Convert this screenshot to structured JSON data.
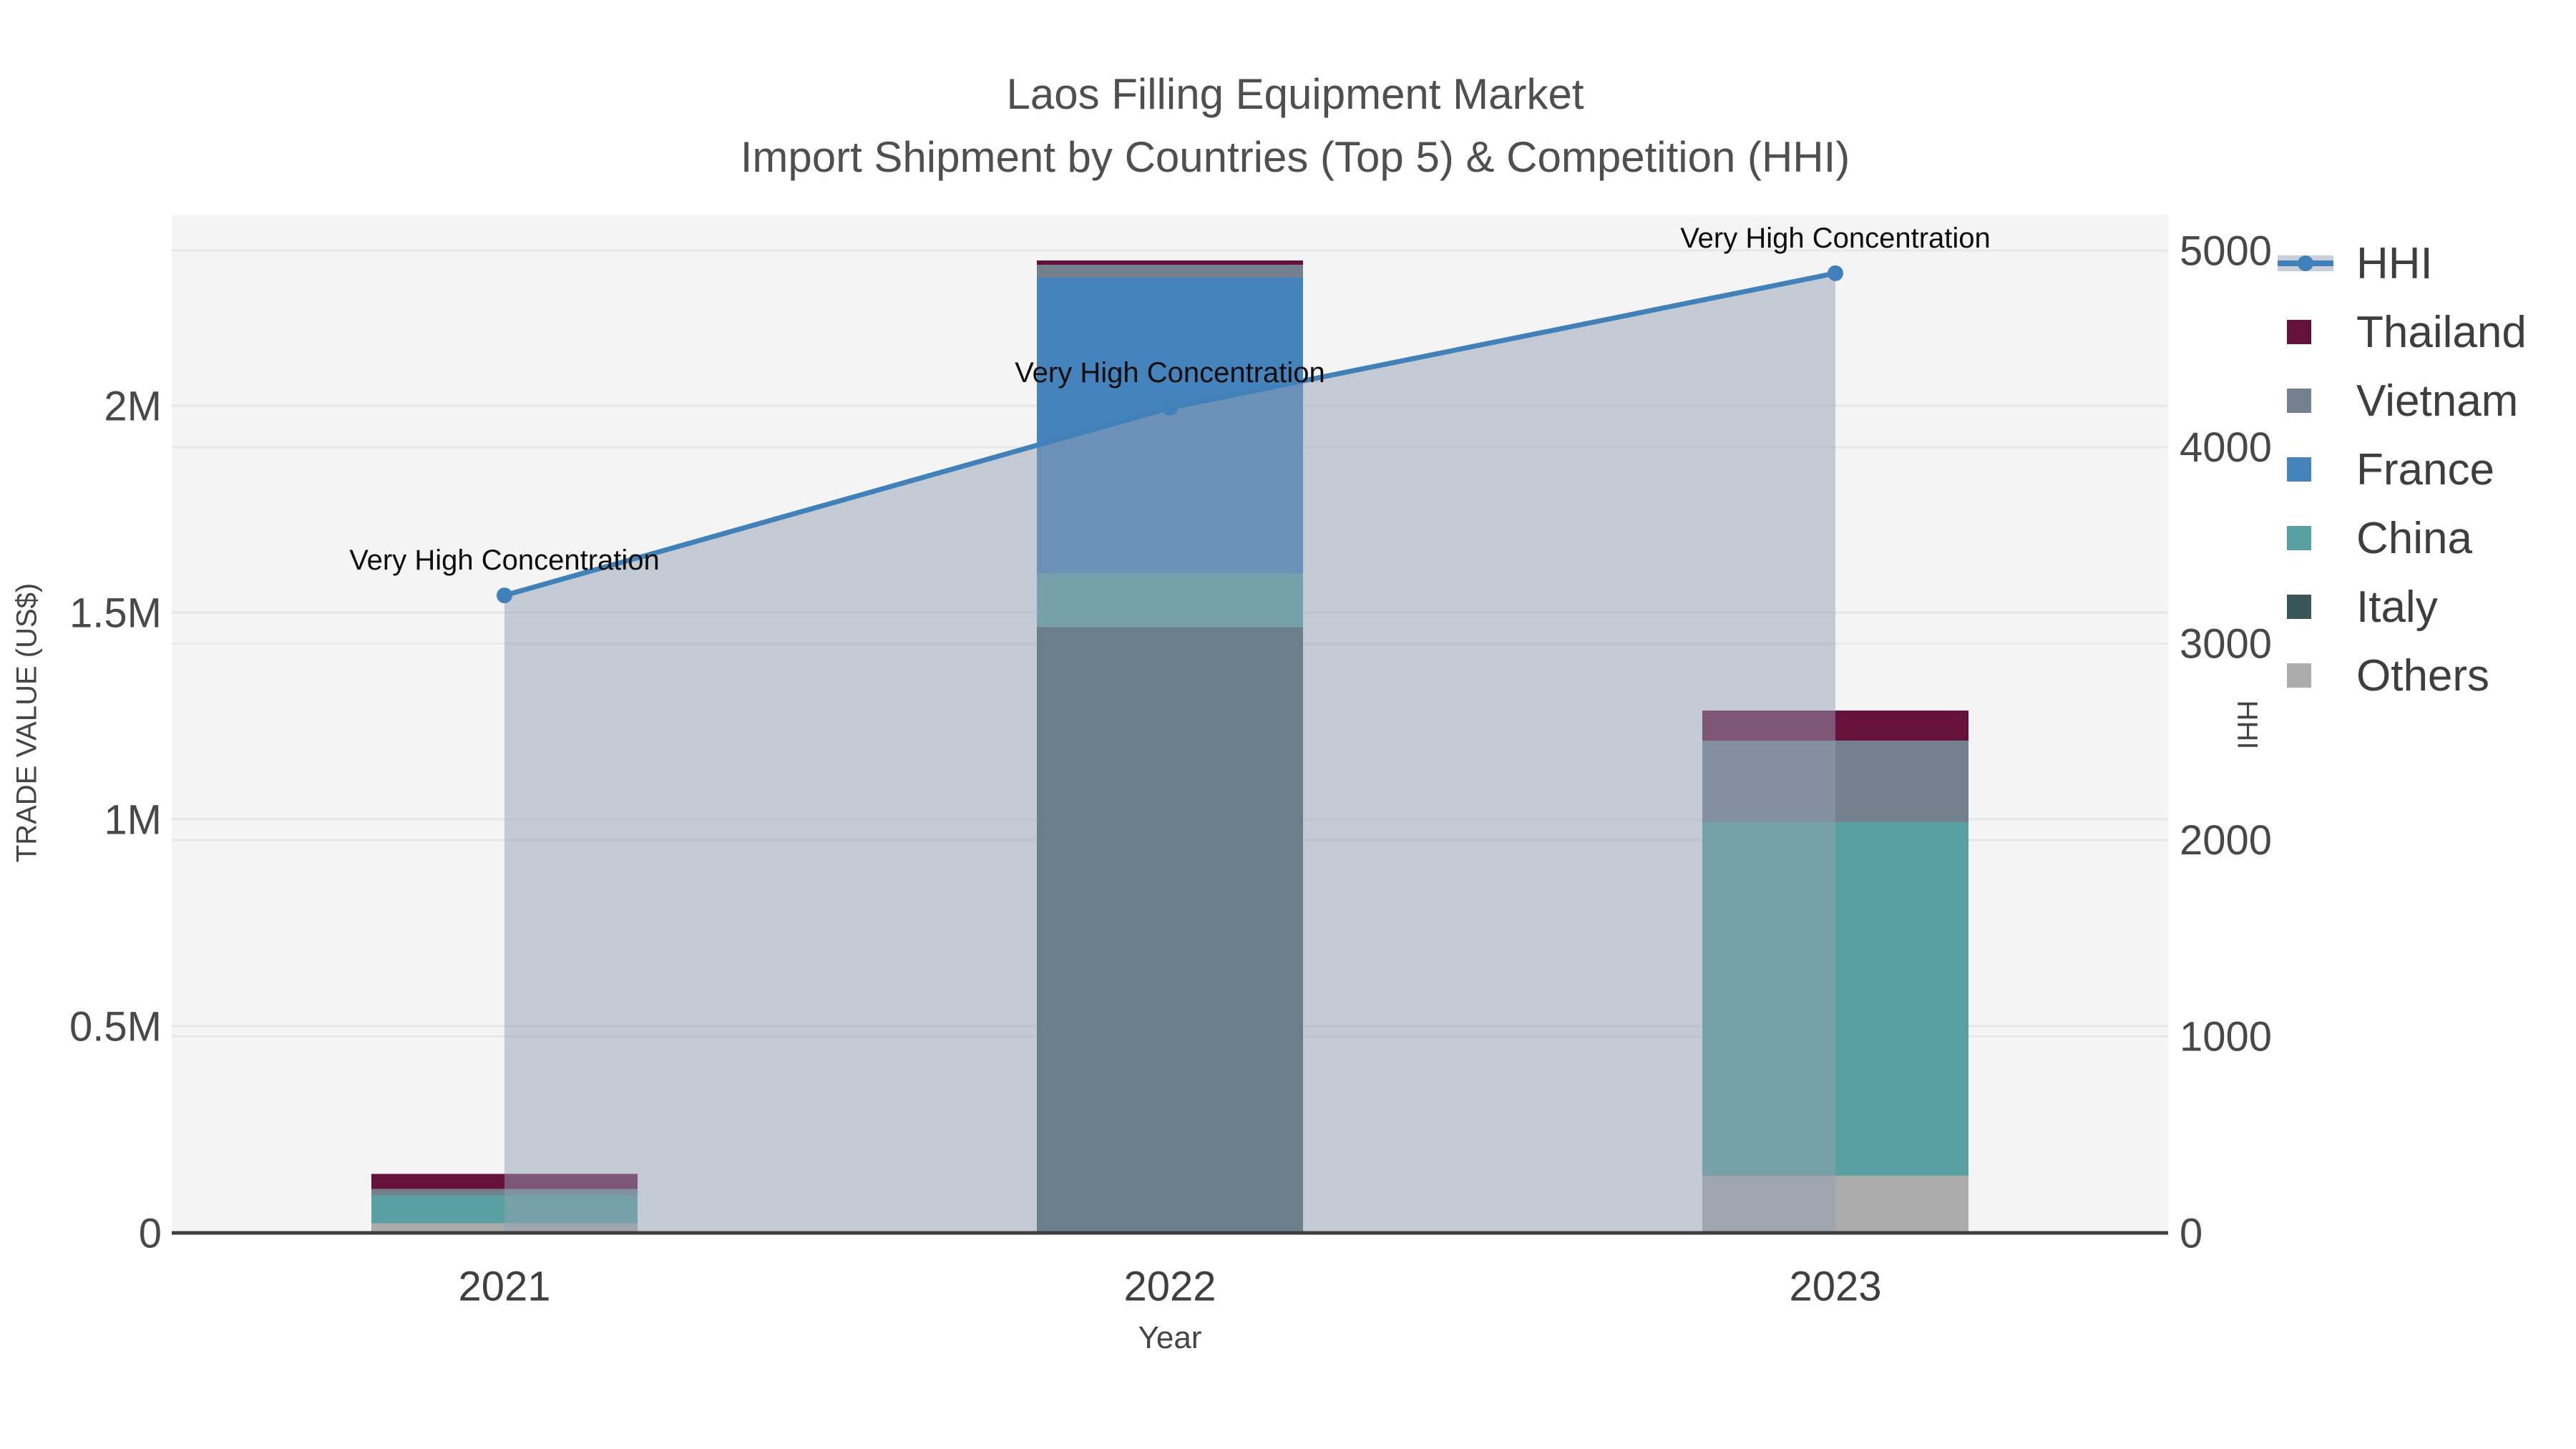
{
  "title": {
    "line1": "Laos Filling Equipment Market",
    "line2": "Import Shipment by Countries (Top 5) & Competition (HHI)"
  },
  "x_axis": {
    "title": "Year",
    "ticks": [
      "2021",
      "2022",
      "2023"
    ]
  },
  "y_left_axis": {
    "title": "TRADE VALUE (US$)",
    "ticks": [
      {
        "label": "0",
        "value": 0
      },
      {
        "label": "0.5M",
        "value": 500000
      },
      {
        "label": "1M",
        "value": 1000000
      },
      {
        "label": "1.5M",
        "value": 1500000
      },
      {
        "label": "2M",
        "value": 2000000
      }
    ]
  },
  "y_right_axis": {
    "title": "HHI",
    "ticks": [
      {
        "label": "0",
        "value": 0
      },
      {
        "label": "1000",
        "value": 1000
      },
      {
        "label": "2000",
        "value": 2000
      },
      {
        "label": "3000",
        "value": 3000
      },
      {
        "label": "4000",
        "value": 4000
      },
      {
        "label": "5000",
        "value": 5000
      }
    ]
  },
  "legend": {
    "items": [
      {
        "label": "HHI",
        "type": "line",
        "color": "#4181B9",
        "band_color": "#C9CFD9"
      },
      {
        "label": "Thailand",
        "type": "swatch",
        "color": "#651139"
      },
      {
        "label": "Vietnam",
        "type": "swatch",
        "color": "#73818F"
      },
      {
        "label": "France",
        "type": "swatch",
        "color": "#4583BD"
      },
      {
        "label": "China",
        "type": "swatch",
        "color": "#58A0A1"
      },
      {
        "label": "Italy",
        "type": "swatch",
        "color": "#395divide658"
      },
      {
        "label": "Others",
        "type": "swatch",
        "color": "#ABABAB"
      }
    ]
  },
  "annotations": [
    {
      "text": "Very High Concentration",
      "year": "2021"
    },
    {
      "text": "Very High Concentration",
      "year": "2022"
    },
    {
      "text": "Very High Concentration",
      "year": "2023"
    }
  ],
  "colors": {
    "plot_bg": "#F4F4F5",
    "grid": "#E7E7EA",
    "axis_line": "#3E3E3E",
    "tick_text": "#484848",
    "x_tick_text": "#3F3F3F",
    "annotation_text": "#0D0D0D",
    "hhi_line": "#4181B9",
    "hhi_area": "rgba(147,159,179,0.5)"
  },
  "chart_data": {
    "type": "bar+line",
    "title": "Laos Filling Equipment Market — Import Shipment by Countries (Top 5) & Competition (HHI)",
    "xlabel": "Year",
    "ylabel_left": "TRADE VALUE (US$)",
    "ylabel_right": "HHI",
    "categories": [
      "2021",
      "2022",
      "2023"
    ],
    "bar_stack_order_bottom_to_top": [
      "Others",
      "Italy",
      "China",
      "France",
      "Vietnam",
      "Thailand"
    ],
    "bar_series": [
      {
        "name": "Others",
        "color": "#ABABAB",
        "values": [
          23000,
          0,
          138000
        ]
      },
      {
        "name": "Italy",
        "color": "#435E60",
        "values": [
          0,
          1465000,
          0
        ]
      },
      {
        "name": "China",
        "color": "#58A0A1",
        "values": [
          68000,
          130000,
          855000
        ]
      },
      {
        "name": "France",
        "color": "#4583BD",
        "values": [
          0,
          715000,
          0
        ]
      },
      {
        "name": "Vietnam",
        "color": "#73818F",
        "values": [
          15000,
          31000,
          197000
        ]
      },
      {
        "name": "Thailand",
        "color": "#651139",
        "values": [
          37000,
          10000,
          73000
        ]
      }
    ],
    "line_series": {
      "name": "HHI",
      "color": "#4181B9",
      "values": [
        3245,
        4200,
        4885
      ]
    },
    "y_left_range": [
      0,
      2462000
    ],
    "y_right_range": [
      0,
      5183
    ],
    "grid": true,
    "legend_position": "right"
  }
}
